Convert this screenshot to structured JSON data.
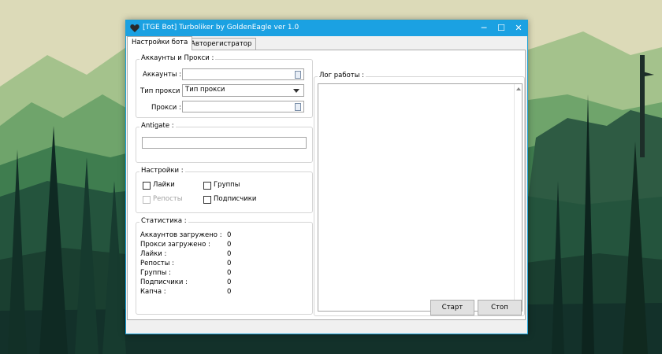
{
  "colors": {
    "titlebar": "#1ba1e2",
    "window_bg": "#f0f0f0"
  },
  "window": {
    "title": "[TGE Bot] Turboliker by GoldenEagle ver 1.0",
    "icon": "heart-icon",
    "controls": {
      "minimize": "─",
      "maximize": "☐",
      "close": "✕"
    }
  },
  "tabs": [
    {
      "label": "Настройки бота",
      "active": true
    },
    {
      "label": "Авторегистратор",
      "active": false
    }
  ],
  "accounts_group": {
    "title": "Аккаунты и Прокси :",
    "accounts_label": "Аккаунты :",
    "accounts_value": "",
    "proxy_type_label": "Тип прокси :",
    "proxy_type_value": "Тип прокси",
    "proxies_label": "Прокси :",
    "proxies_value": ""
  },
  "antigate_group": {
    "title": "Antigate :",
    "value": ""
  },
  "settings_group": {
    "title": "Настройки :",
    "likes": {
      "label": "Лайки",
      "checked": false,
      "enabled": true
    },
    "groups": {
      "label": "Группы",
      "checked": false,
      "enabled": true
    },
    "reposts": {
      "label": "Репосты",
      "checked": false,
      "enabled": false
    },
    "subscribers": {
      "label": "Подписчики",
      "checked": false,
      "enabled": true
    }
  },
  "stats_group": {
    "title": "Статистика :",
    "rows": [
      {
        "label": "Аккаунтов загружено :",
        "value": "0"
      },
      {
        "label": "Прокси загружено :",
        "value": "0"
      },
      {
        "label": "Лайки :",
        "value": "0"
      },
      {
        "label": "Репосты :",
        "value": "0"
      },
      {
        "label": "Группы :",
        "value": "0"
      },
      {
        "label": "Подписчики :",
        "value": "0"
      },
      {
        "label": "Капча :",
        "value": "0"
      }
    ]
  },
  "log_group": {
    "title": "Лог работы :",
    "content": ""
  },
  "buttons": {
    "start": "Старт",
    "stop": "Стоп"
  }
}
